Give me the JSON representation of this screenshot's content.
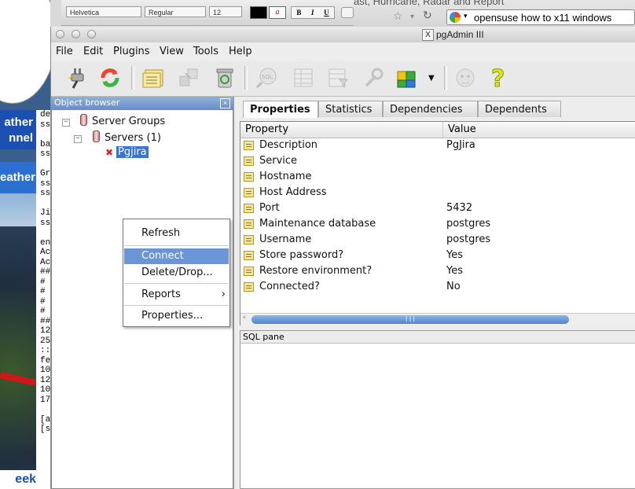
{
  "background": {
    "weather": {
      "banner1": "ather\nnnel",
      "banner2": "eather",
      "bottom": "eek"
    },
    "text_column": [
      "de",
      "ss",
      "",
      "ba",
      "ss",
      "",
      "Gr",
      "ss",
      "ss",
      "",
      "Jir",
      "ss",
      "",
      "en",
      "Ac",
      "Ac",
      "##",
      "# I",
      "#",
      "# I",
      "# v",
      "##",
      "12",
      "25",
      "::1",
      "fe",
      "10",
      "12",
      "10",
      "17",
      "",
      "[al",
      "[su"
    ],
    "format_bar": {
      "font": "Helvetica",
      "style": "Regular",
      "size": "12"
    },
    "browser": {
      "tab_text": "ast, Hurricane, Radar and Report",
      "url": "opensuse how to x11 windows"
    }
  },
  "window": {
    "title": "pgAdmin III"
  },
  "menubar": [
    "File",
    "Edit",
    "Plugins",
    "View",
    "Tools",
    "Help"
  ],
  "toolbar": [
    {
      "name": "connect-plug-icon"
    },
    {
      "name": "refresh-icon"
    },
    {
      "name": "properties-icon"
    },
    {
      "name": "create-object-icon"
    },
    {
      "name": "drop-trash-icon"
    },
    {
      "name": "sql-query-icon"
    },
    {
      "name": "view-data-icon"
    },
    {
      "name": "filtered-data-icon"
    },
    {
      "name": "maintenance-wrench-icon"
    },
    {
      "name": "plugins-puzzle-icon"
    },
    {
      "name": "guru-hints-icon"
    },
    {
      "name": "help-question-icon"
    }
  ],
  "object_browser": {
    "title": "Object browser",
    "close": "x",
    "tree": {
      "server_groups": "Server Groups",
      "servers": "Servers (1)",
      "server": "Pgjira"
    }
  },
  "context_menu": {
    "refresh": "Refresh",
    "connect": "Connect",
    "delete": "Delete/Drop...",
    "reports": "Reports",
    "properties": "Properties..."
  },
  "tabs": [
    "Properties",
    "Statistics",
    "Dependencies",
    "Dependents"
  ],
  "properties": {
    "headers": {
      "property": "Property",
      "value": "Value"
    },
    "rows": [
      {
        "name": "Description",
        "value": "PgJira"
      },
      {
        "name": "Service",
        "value": ""
      },
      {
        "name": "Hostname",
        "value": ""
      },
      {
        "name": "Host Address",
        "value": ""
      },
      {
        "name": "Port",
        "value": "5432"
      },
      {
        "name": "Maintenance database",
        "value": "postgres"
      },
      {
        "name": "Username",
        "value": "postgres"
      },
      {
        "name": "Store password?",
        "value": "Yes"
      },
      {
        "name": "Restore environment?",
        "value": "Yes"
      },
      {
        "name": "Connected?",
        "value": "No"
      }
    ]
  },
  "sql_pane": {
    "title": "SQL pane"
  },
  "colors": {
    "selection": "#3874d8",
    "ob_header": "#7a9ad0",
    "scroll_thumb": "#4f86cc"
  }
}
